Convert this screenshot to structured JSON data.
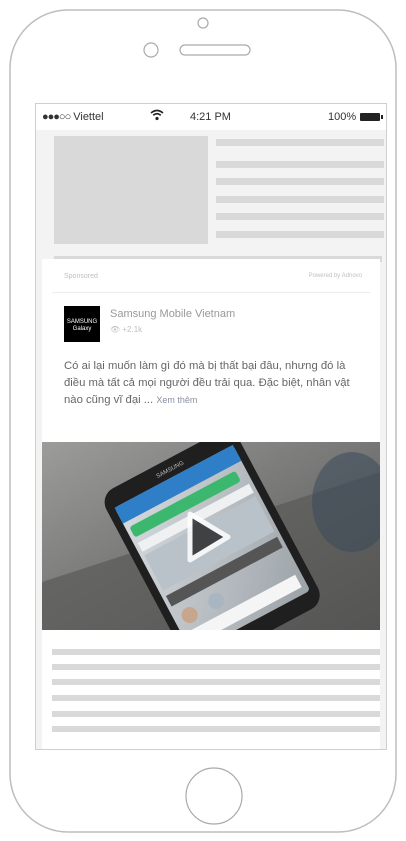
{
  "status_bar": {
    "signal": "●●●○○",
    "carrier": "Viettel",
    "wifi": "wifi-icon",
    "time": "4:21 PM",
    "battery": "100%"
  },
  "ad": {
    "sponsored_label": "Sponsored",
    "powered_by": "Powered by Adnovo",
    "advertiser_logo_text": "SAMSUNG Galaxy",
    "page_name": "Samsung Mobile Vietnam",
    "meta": "👁 +2.1k",
    "body_text": "Có ai lại muốn làm gì đó mà bị thất bại đâu, nhưng đó là điều mà tất cả mọi người đều trải qua. Đặc biệt, nhân vật nào cũng vĩ đại ...",
    "see_more": "Xem thêm",
    "video_phone_brand": "SAMSUNG",
    "play_icon": "play-icon"
  },
  "colors": {
    "placeholder": "#d9d9d9",
    "screen_bg": "#f3f3f3",
    "device_outline": "#bdbdbd"
  }
}
